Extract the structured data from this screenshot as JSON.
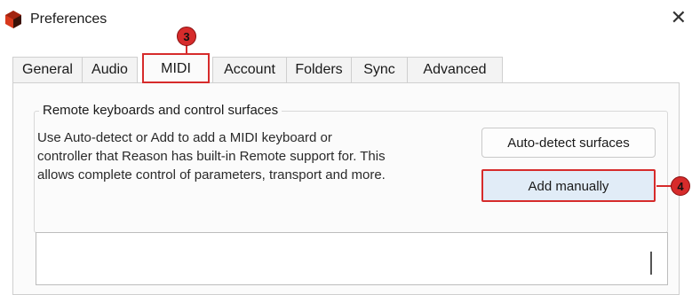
{
  "window": {
    "title": "Preferences",
    "close_glyph": "✕",
    "app_icon": "reason-logo-icon",
    "colors": {
      "annotation": "#d62b2b",
      "primary_button_bg": "#e1ecf7"
    }
  },
  "tabs": [
    {
      "label": "General"
    },
    {
      "label": "Audio"
    },
    {
      "label": "MIDI",
      "active": true
    },
    {
      "label": "Account"
    },
    {
      "label": "Folders"
    },
    {
      "label": "Sync"
    },
    {
      "label": "Advanced"
    }
  ],
  "remote_group": {
    "title": "Remote keyboards and control surfaces",
    "description_lines": [
      "Use Auto-detect or Add to add a MIDI keyboard or",
      "controller that Reason has built-in Remote support for. This",
      "allows complete control of parameters, transport and more."
    ],
    "autodetect_label": "Auto-detect surfaces",
    "add_manually_label": "Add manually"
  },
  "annotations": {
    "step_midi_tab": "3",
    "step_add_manually": "4"
  }
}
